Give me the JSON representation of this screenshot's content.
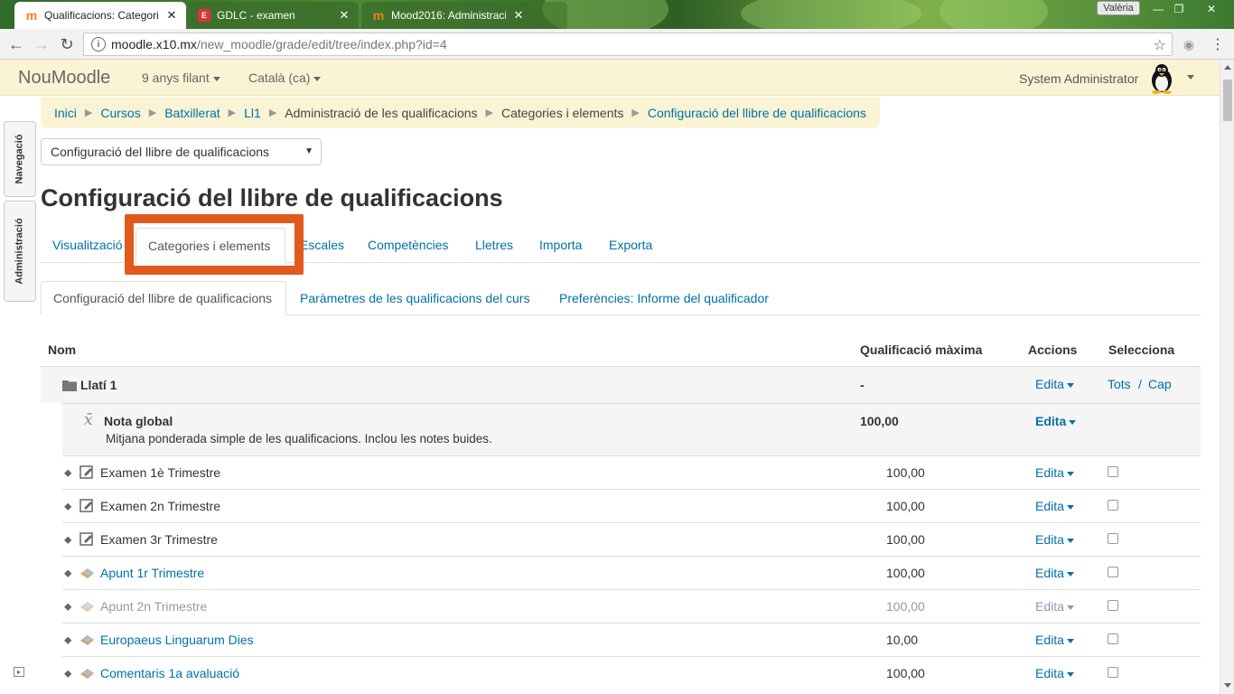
{
  "browser": {
    "tabs": [
      {
        "title": "Qualificacions: Categorie",
        "active": true
      },
      {
        "title": "GDLC - examen",
        "active": false
      },
      {
        "title": "Mood2016: Administraci",
        "active": false
      }
    ],
    "user_chip": "Valèria",
    "url_host": "moodle.x10.mx",
    "url_path": "/new_moodle/grade/edit/tree/index.php?id=4"
  },
  "navbar": {
    "brand": "NouMoodle",
    "menu1": "9 anys filant",
    "menu2": "Català (ca)",
    "user": "System Administrator"
  },
  "dock": {
    "nav": "Navegació",
    "admin": "Administració"
  },
  "breadcrumb": [
    "Inici",
    "Cursos",
    "Batxillerat",
    "Ll1",
    "Administració de les qualificacions",
    "Categories i elements",
    "Configuració del llibre de qualificacions"
  ],
  "jump_select": "Configuració del llibre de qualificacions",
  "page_title": "Configuració del llibre de qualificacions",
  "tabs_primary": [
    "Visualització",
    "Categories i elements",
    "Escales",
    "Competències",
    "Lletres",
    "Importa",
    "Exporta"
  ],
  "tabs_secondary": [
    "Configuració del llibre de qualificacions",
    "Paràmetres de les qualificacions del curs",
    "Preferències: Informe del qualificador"
  ],
  "table": {
    "headers": {
      "name": "Nom",
      "max": "Qualificació màxima",
      "actions": "Accions",
      "select": "Selecciona"
    },
    "category": {
      "name": "Llatí 1",
      "max": "-",
      "action": "Edita",
      "select_all": "Tots",
      "select_sep": "/",
      "select_none": "Cap"
    },
    "total": {
      "name": "Nota global",
      "desc": "Mitjana ponderada simple de les qualificacions. Inclou les notes buides.",
      "max": "100,00",
      "action": "Edita"
    },
    "items": [
      {
        "name": "Examen 1è Trimestre",
        "max": "100,00",
        "action": "Edita"
      },
      {
        "name": "Examen 2n Trimestre",
        "max": "100,00",
        "action": "Edita"
      },
      {
        "name": "Examen 3r Trimestre",
        "max": "100,00",
        "action": "Edita"
      },
      {
        "name": "Apunt 1r Trimestre",
        "max": "100,00",
        "action": "Edita"
      },
      {
        "name": "Apunt 2n Trimestre",
        "max": "100,00",
        "action": "Edita"
      },
      {
        "name": "Europaeus Linguarum Dies",
        "max": "10,00",
        "action": "Edita"
      },
      {
        "name": "Comentaris 1a avaluació",
        "max": "100,00",
        "action": "Edita"
      }
    ]
  }
}
